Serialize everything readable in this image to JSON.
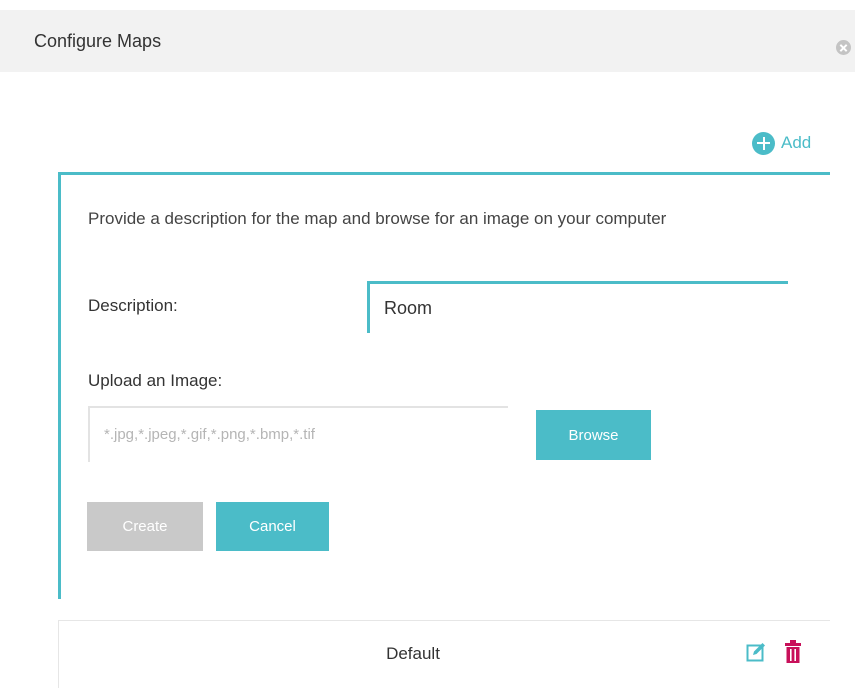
{
  "dialog": {
    "title": "Configure Maps"
  },
  "toolbar": {
    "add_label": "Add"
  },
  "form": {
    "instructions": "Provide a description for the map and browse for an image on your computer",
    "description_label": "Description:",
    "description_value": "Room",
    "upload_label": "Upload an Image:",
    "file_placeholder": "*.jpg,*.jpeg,*.gif,*.png,*.bmp,*.tif",
    "browse_label": "Browse",
    "create_label": "Create",
    "cancel_label": "Cancel"
  },
  "maps": [
    {
      "name": "Default"
    }
  ],
  "icons": {
    "close": "close-icon",
    "add": "plus-circle-icon",
    "edit": "edit-icon",
    "delete": "trash-icon"
  },
  "colors": {
    "accent": "#4bbcc8",
    "disabled_button": "#c9c9c9",
    "delete": "#c8105a",
    "header_bg": "#f2f2f2"
  }
}
